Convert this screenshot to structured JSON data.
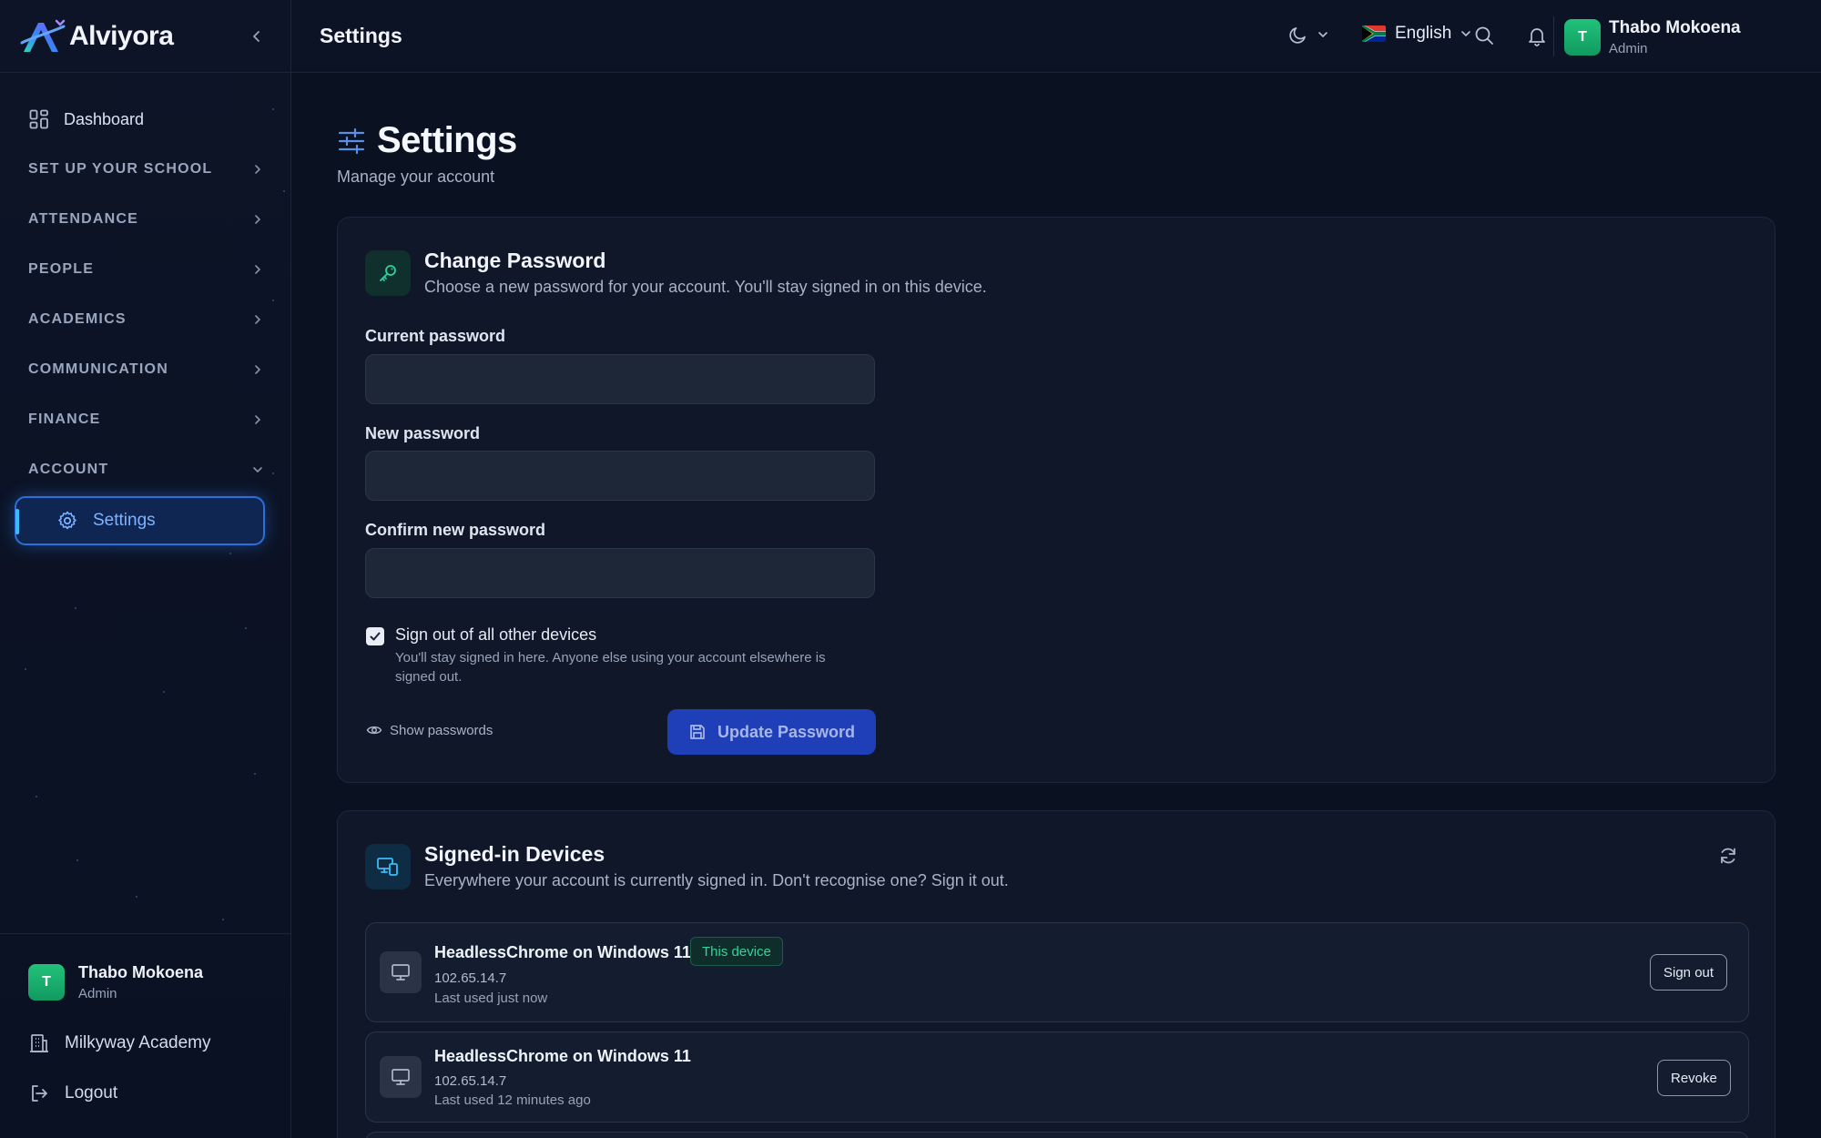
{
  "app": {
    "name": "Alviyora"
  },
  "sidebar": {
    "dashboard_label": "Dashboard",
    "sections": [
      {
        "label": "SET UP YOUR SCHOOL",
        "expanded": false
      },
      {
        "label": "ATTENDANCE",
        "expanded": false
      },
      {
        "label": "PEOPLE",
        "expanded": false
      },
      {
        "label": "ACADEMICS",
        "expanded": false
      },
      {
        "label": "COMMUNICATION",
        "expanded": false
      },
      {
        "label": "FINANCE",
        "expanded": false
      },
      {
        "label": "ACCOUNT",
        "expanded": true
      }
    ],
    "active_item": "Settings",
    "user": {
      "initial": "T",
      "name": "Thabo Mokoena",
      "role": "Admin"
    },
    "school_label": "Milkyway Academy",
    "logout_label": "Logout"
  },
  "topbar": {
    "title": "Settings",
    "language": "English",
    "user": {
      "initial": "T",
      "name": "Thabo Mokoena",
      "role": "Admin"
    }
  },
  "page": {
    "title": "Settings",
    "subtitle": "Manage your account"
  },
  "password_card": {
    "title": "Change Password",
    "description": "Choose a new password for your account. You'll stay signed in on this device.",
    "current_label": "Current password",
    "current_value": "",
    "new_label": "New password",
    "new_value": "",
    "confirm_label": "Confirm new password",
    "confirm_value": "",
    "signout_checkbox_label": "Sign out of all other devices",
    "signout_checked": true,
    "signout_help": "You'll stay signed in here. Anyone else using your account elsewhere is signed out.",
    "show_passwords_label": "Show passwords",
    "submit_label": "Update Password"
  },
  "devices_card": {
    "title": "Signed-in Devices",
    "description": "Everywhere your account is currently signed in. Don't recognise one? Sign it out.",
    "devices": [
      {
        "name": "HeadlessChrome on Windows 11",
        "ip": "102.65.14.7",
        "last_used": "Last used just now",
        "badge": "This device",
        "action": "Sign out"
      },
      {
        "name": "HeadlessChrome on Windows 11",
        "ip": "102.65.14.7",
        "last_used": "Last used 12 minutes ago",
        "badge": "",
        "action": "Revoke"
      }
    ]
  },
  "colors": {
    "accent": "#2b6fd8",
    "primary_button": "#1f3fb8",
    "success": "#34d399",
    "background": "#0a1120"
  }
}
